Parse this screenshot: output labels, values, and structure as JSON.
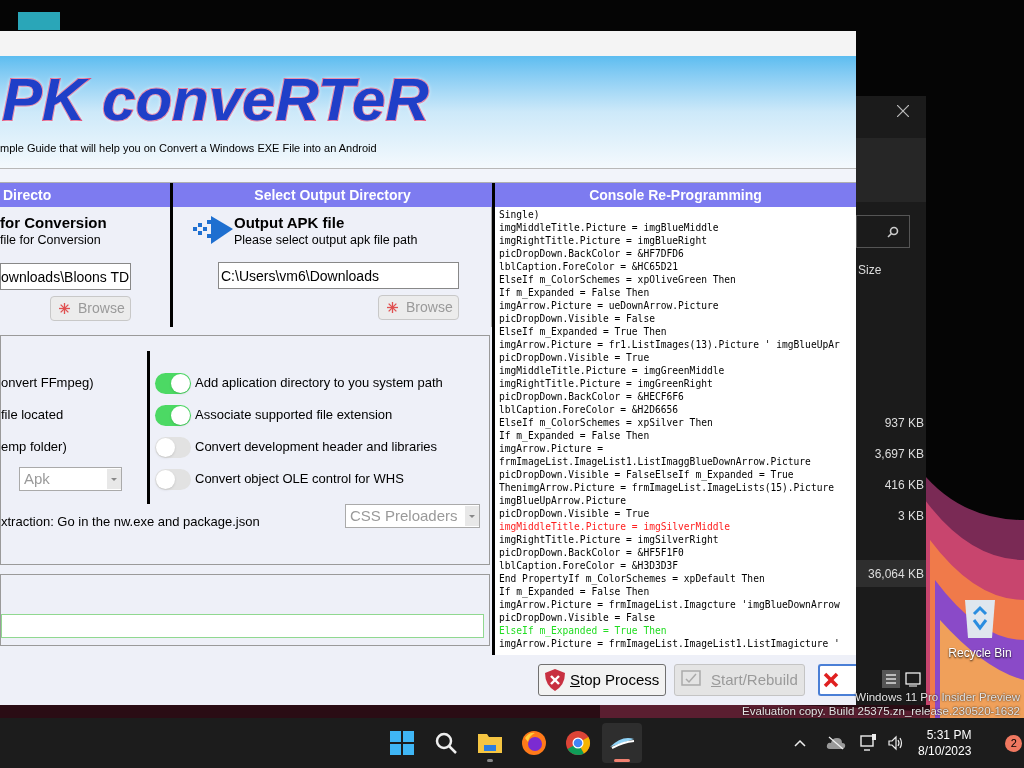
{
  "app_window": {
    "logo": "PK conveRTeR",
    "subtitle": "mple Guide that will help you on  Convert a Windows EXE File into an Android",
    "input_panel": {
      "header": "Directo",
      "title": "for Conversion",
      "description": "file for Conversion",
      "path": "ownloads\\Bloons TD",
      "browse": {
        "label": "Browse",
        "disabled": true
      }
    },
    "output_panel": {
      "header": "Select Output Directory",
      "title": "Output APK file",
      "description": "Please select output apk file path",
      "path": "C:\\Users\\vm6\\Downloads",
      "browse": {
        "label": "Browse",
        "disabled": true
      }
    },
    "options": {
      "left_labels": [
        "onvert FFmpeg)",
        "file located",
        "emp folder)"
      ],
      "format": {
        "value": "Apk",
        "disabled": true
      },
      "toggles": [
        {
          "label": "Add aplication directory to you system path",
          "on": true
        },
        {
          "label": "Associate supported file extension",
          "on": true
        },
        {
          "label": "Convert development header and libraries",
          "on": false
        },
        {
          "label": "Convert object OLE control for WHS",
          "on": false
        }
      ],
      "note": "xtraction: Go in the nw.exe and package.json",
      "preloader": {
        "value": "CSS Preloaders",
        "disabled": true
      }
    },
    "console": {
      "header": "Console Re-Programming",
      "lines": [
        {
          "text": "Single)",
          "kind": "plain"
        },
        {
          "text": "imgMiddleTitle.Picture = imgBlueMiddle",
          "kind": "plain"
        },
        {
          "text": "imgRightTitle.Picture = imgBlueRight",
          "kind": "plain"
        },
        {
          "text": "picDropDown.BackColor = &HF7DFD6",
          "kind": "plain"
        },
        {
          "text": "lblCaption.ForeColor = &HC65D21",
          "kind": "plain"
        },
        {
          "text": "ElseIf m_ColorSchemes = xpOliveGreen Then",
          "kind": "plain"
        },
        {
          "text": "If m_Expanded = False Then",
          "kind": "plain"
        },
        {
          "text": "imgArrow.Picture = ueDownArrow.Picture",
          "kind": "plain"
        },
        {
          "text": "picDropDown.Visible = False",
          "kind": "plain"
        },
        {
          "text": "ElseIf m_Expanded = True Then",
          "kind": "plain"
        },
        {
          "text": "imgArrow.Picture = fr1.ListImages(13).Picture ' imgBlueUpAr",
          "kind": "plain"
        },
        {
          "text": "picDropDown.Visible = True",
          "kind": "plain"
        },
        {
          "text": "imgMiddleTitle.Picture = imgGreenMiddle",
          "kind": "plain"
        },
        {
          "text": "imgRightTitle.Picture = imgGreenRight",
          "kind": "plain"
        },
        {
          "text": "picDropDown.BackColor = &HECF6F6",
          "kind": "plain"
        },
        {
          "text": "lblCaption.ForeColor = &H2D6656",
          "kind": "plain"
        },
        {
          "text": "ElseIf m_ColorSchemes = xpSilver Then",
          "kind": "plain"
        },
        {
          "text": "If m_Expanded = False Then",
          "kind": "plain"
        },
        {
          "text": "imgArrow.Picture =",
          "kind": "plain"
        },
        {
          "text": "frmImageList.ImageList1.ListImaggBlueDownArrow.Picture",
          "kind": "plain"
        },
        {
          "text": "picDropDown.Visible = FalseElseIf m_Expanded = True",
          "kind": "plain"
        },
        {
          "text": "ThenimgArrow.Picture = frmImageList.ImageLists(15).Picture",
          "kind": "plain"
        },
        {
          "text": "imgBlueUpArrow.Picture",
          "kind": "plain"
        },
        {
          "text": "picDropDown.Visible = True",
          "kind": "plain"
        },
        {
          "text": "imgMiddleTitle.Picture = imgSilverMiddle",
          "kind": "error"
        },
        {
          "text": "imgRightTitle.Picture = imgSilverRight",
          "kind": "plain"
        },
        {
          "text": "picDropDown.BackColor = &HF5F1F0",
          "kind": "plain"
        },
        {
          "text": "lblCaption.ForeColor = &H3D3D3F",
          "kind": "plain"
        },
        {
          "text": "End PropertyIf m_ColorSchemes = xpDefault Then",
          "kind": "plain"
        },
        {
          "text": "If m_Expanded = False Then",
          "kind": "plain"
        },
        {
          "text": "imgArrow.Picture = frmImageList.Imagcture 'imgBlueDownArrow",
          "kind": "plain"
        },
        {
          "text": "picDropDown.Visible = False",
          "kind": "plain"
        },
        {
          "text": "ElseIf m_Expanded = True Then",
          "kind": "success"
        },
        {
          "text": "imgArrow.Picture = frmImageList.ImageList1.ListImagicture '",
          "kind": "plain"
        }
      ]
    },
    "buttons": [
      {
        "kind": "stop",
        "label": "Stop Process",
        "disabled": false
      },
      {
        "kind": "start",
        "label": "Start/Rebuild",
        "disabled": true
      },
      {
        "kind": "close",
        "disabled": false
      }
    ]
  },
  "explorer": {
    "column": "Size",
    "rows": [
      {
        "size": "937 KB",
        "selected": false
      },
      {
        "size": "3,697 KB",
        "selected": false
      },
      {
        "size": "416 KB",
        "selected": false
      },
      {
        "size": "3 KB",
        "selected": false
      },
      {
        "size": "36,064 KB",
        "selected": true
      }
    ]
  },
  "desktop": {
    "recycle_bin": "Recycle Bin",
    "watermark": [
      "Windows 11 Pro Insider Preview",
      "Evaluation copy. Build 25375.zn_release.230520-1632"
    ]
  },
  "taskbar": {
    "apps": [
      {
        "kind": "start",
        "selected": false,
        "running": false
      },
      {
        "kind": "search",
        "selected": false,
        "running": false
      },
      {
        "kind": "explorer",
        "selected": false,
        "running": true
      },
      {
        "kind": "firefox",
        "selected": false,
        "running": false
      },
      {
        "kind": "chrome",
        "selected": false,
        "running": false
      },
      {
        "kind": "converter",
        "selected": true,
        "running": true
      }
    ],
    "time": "5:31 PM",
    "date": "8/10/2023",
    "badge": "2"
  }
}
